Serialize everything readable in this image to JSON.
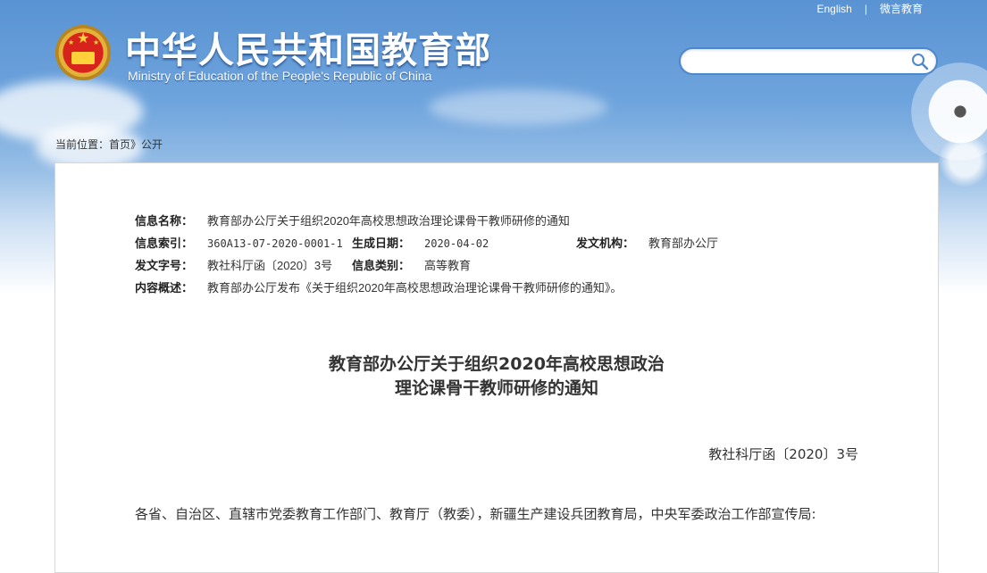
{
  "header": {
    "title": "中华人民共和国教育部",
    "subtitle": "Ministry of Education of the People's Republic of China",
    "links": [
      "English",
      "微言教育"
    ],
    "search_placeholder": ""
  },
  "breadcrumb": {
    "prefix": "当前位置：",
    "home": "首页",
    "separator": "》",
    "current": "公开"
  },
  "meta": {
    "info_name_label": "信息名称：",
    "info_name_value": "教育部办公厅关于组织2020年高校思想政治理论课骨干教师研修的通知",
    "index_label": "信息索引：",
    "index_value": "360A13-07-2020-0001-1",
    "date_label": "生成日期：",
    "date_value": "2020-04-02",
    "issuer_label": "发文机构：",
    "issuer_value": "教育部办公厅",
    "docno_label": "发文字号：",
    "docno_value": "教社科厅函〔2020〕3号",
    "category_label": "信息类别：",
    "category_value": "高等教育",
    "summary_label": "内容概述：",
    "summary_value": "教育部办公厅发布《关于组织2020年高校思想政治理论课骨干教师研修的通知》。"
  },
  "document": {
    "title_line1": "教育部办公厅关于组织2020年高校思想政治",
    "title_line2": "理论课骨干教师研修的通知",
    "number": "教社科厅函〔2020〕3号",
    "salutation": "各省、自治区、直辖市党委教育工作部门、教育厅（教委），新疆生产建设兵团教育局，中央军委政治工作部宣传局:"
  },
  "colors": {
    "sky_top": "#5a93d3",
    "search_border": "#4f87cc",
    "emblem_red": "#d8231c",
    "emblem_gold": "#ffd23a",
    "text": "#333333"
  }
}
